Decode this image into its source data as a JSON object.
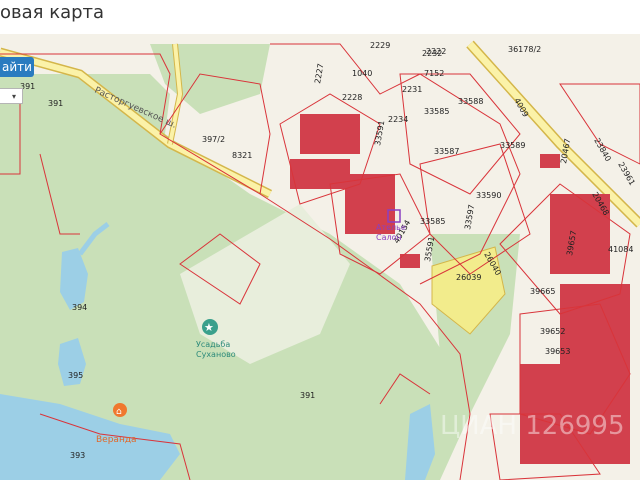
{
  "page": {
    "title": "овая карта"
  },
  "toolbar": {
    "find_label": "айти",
    "select_caret": "▾"
  },
  "colors": {
    "map_background": "#f4f1e8",
    "forest": "#c9e0b8",
    "water": "#9ccfe6",
    "road_fill": "#fbf2a8",
    "road_border": "#d4b64a",
    "cadastral_line": "#d9343a",
    "building_fill": "#d2404d",
    "highlight_parcel": "#f2ec8c",
    "poi_green": "#3aa08c",
    "poi_orange": "#f0782e",
    "poi_purple": "#8a3fc1"
  },
  "map": {
    "streets": [
      "Расторгуевское ш."
    ],
    "pois": [
      {
        "name": "Усадьба\nСуханово",
        "icon": "star-icon"
      },
      {
        "name": "Веранда",
        "icon": "restaurant-icon"
      },
      {
        "name": "Ателье\nСалон",
        "icon": "shop-icon"
      }
    ],
    "parcel_labels": [
      "391",
      "391",
      "391",
      "393",
      "394",
      "395",
      "397/2",
      "8321",
      "2227",
      "2228",
      "2229",
      "2231",
      "2232",
      "2234",
      "1040",
      "7152",
      "33585",
      "33585",
      "33587",
      "33588",
      "33589",
      "33590",
      "33591",
      "33597",
      "35591",
      "36178/2",
      "4009",
      "2222",
      "40154",
      "26039",
      "26040",
      "20467",
      "20468",
      "23961",
      "23840",
      "39657",
      "39665",
      "41084",
      "39652",
      "39653"
    ],
    "watermark": "ЦИАН 126995"
  }
}
